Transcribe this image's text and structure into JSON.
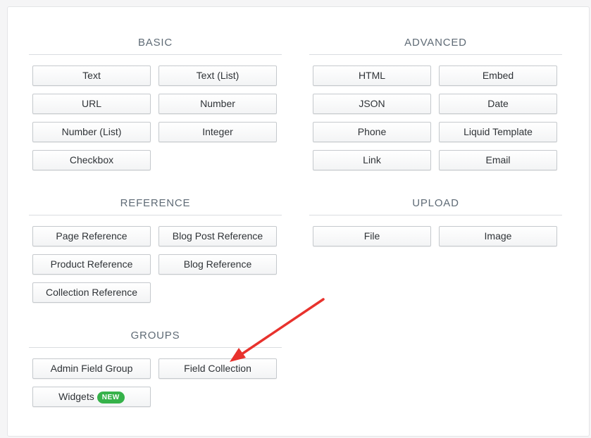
{
  "sections": {
    "basic": {
      "title": "BASIC",
      "buttons": [
        "Text",
        "Text (List)",
        "URL",
        "Number",
        "Number (List)",
        "Integer",
        "Checkbox"
      ]
    },
    "advanced": {
      "title": "ADVANCED",
      "buttons": [
        "HTML",
        "Embed",
        "JSON",
        "Date",
        "Phone",
        "Liquid Template",
        "Link",
        "Email"
      ]
    },
    "reference": {
      "title": "REFERENCE",
      "buttons": [
        "Page Reference",
        "Blog Post Reference",
        "Product Reference",
        "Blog Reference",
        "Collection Reference"
      ]
    },
    "upload": {
      "title": "UPLOAD",
      "buttons": [
        "File",
        "Image"
      ]
    },
    "groups": {
      "title": "GROUPS",
      "buttons": [
        "Admin Field Group",
        "Field Collection",
        "Widgets"
      ],
      "badge": "NEW"
    }
  },
  "annotation": {
    "arrow_color": "#e8322d",
    "target": "Field Collection"
  }
}
